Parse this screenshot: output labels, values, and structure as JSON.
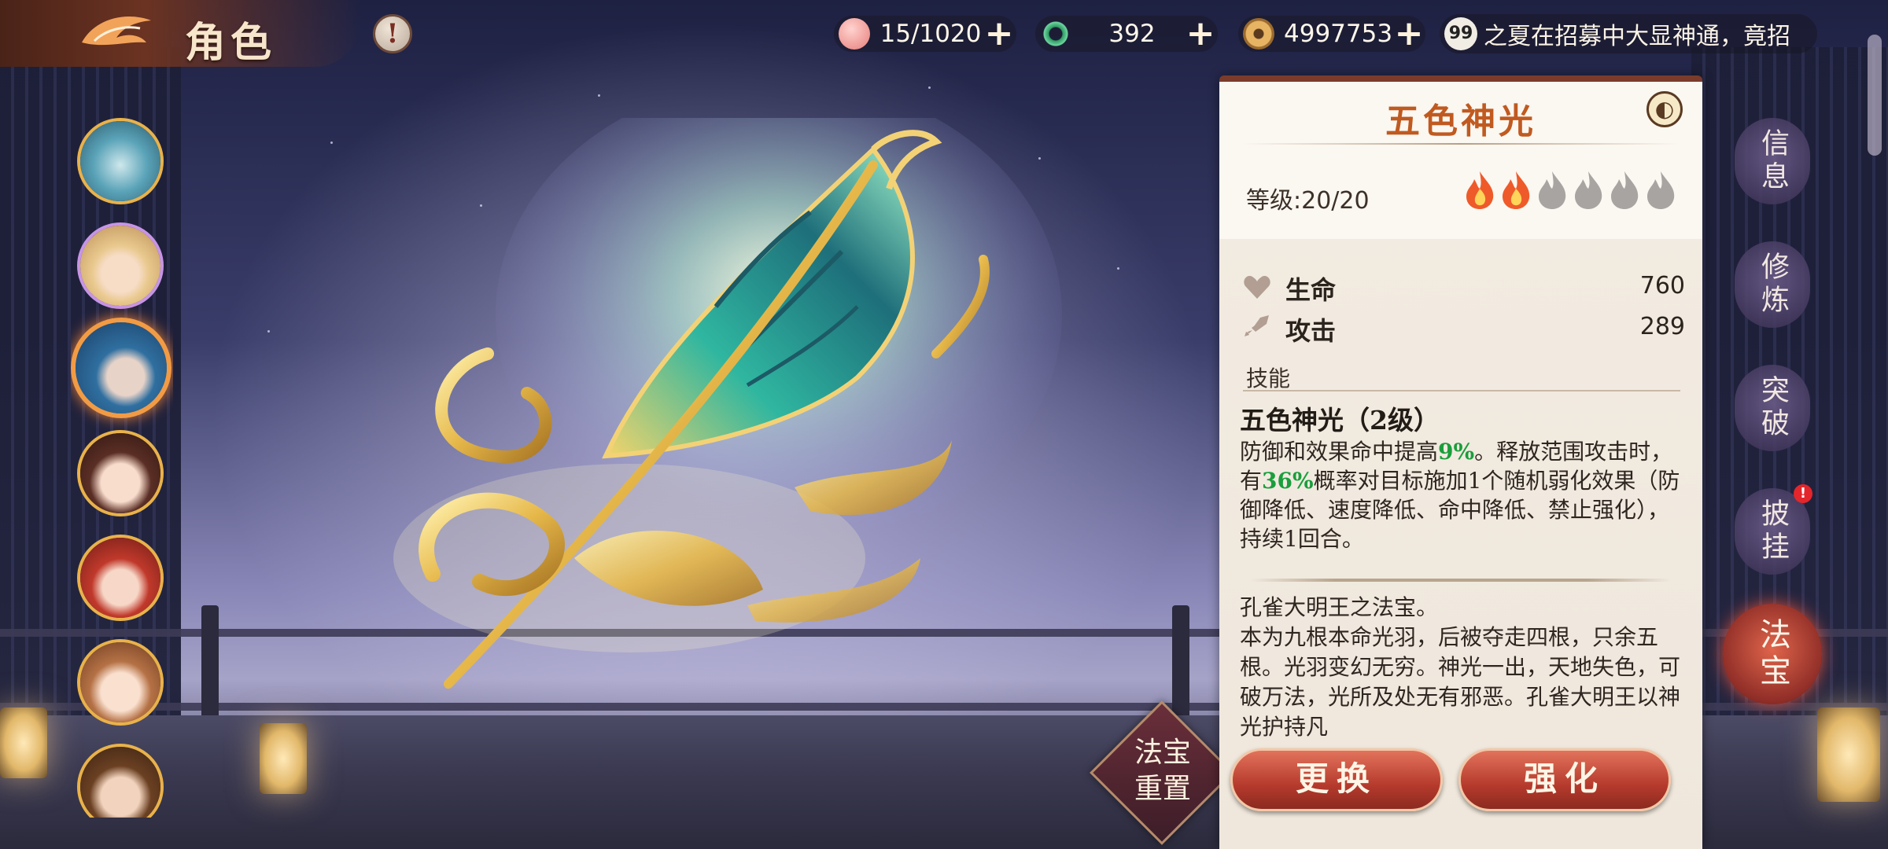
{
  "header": {
    "title": "角色",
    "alert_symbol": "!"
  },
  "resources": [
    {
      "name": "peach-icon",
      "value": "15/1020",
      "plus": "+",
      "color": "#f2a0a0"
    },
    {
      "name": "jade-ring-icon",
      "value": "392",
      "plus": "+",
      "color": "#3fa36b"
    },
    {
      "name": "copper-coin-icon",
      "value": "4997753",
      "plus": "+",
      "color": "#c9924a"
    }
  ],
  "ticker": {
    "icon_text": "99",
    "text": "之夏在招募中大显神通，竟招"
  },
  "characters": [
    {
      "name": "portrait-dragon",
      "selected": false
    },
    {
      "name": "portrait-blonde-girl",
      "selected": false
    },
    {
      "name": "portrait-blue-hair",
      "selected": true
    },
    {
      "name": "portrait-brown-hair-girl",
      "selected": false
    },
    {
      "name": "portrait-red-hair",
      "selected": false
    },
    {
      "name": "portrait-auburn-girl",
      "selected": false
    },
    {
      "name": "portrait-boy",
      "selected": false
    }
  ],
  "reset_button": {
    "line1": "法宝",
    "line2": "重置"
  },
  "panel": {
    "title": "五色神光",
    "level": "等级:20/20",
    "flames_total": 6,
    "flames_lit": 2,
    "stats": [
      {
        "icon": "heart-icon",
        "label": "生命",
        "value": "760"
      },
      {
        "icon": "sword-icon",
        "label": "攻击",
        "value": "289"
      }
    ],
    "skill_section": "技能",
    "skill_name": "五色神光（2级）",
    "skill_desc": {
      "p1": "防御和效果命中提高",
      "h1": "9%",
      "p2": "。释放范围攻击时，有",
      "h2": "36%",
      "p3": "概率对目标施加1个随机弱化效果（防御降低、速度降低、命中降低、禁止强化），持续1回合。"
    },
    "lore": "孔雀大明王之法宝。\n本为九根本命光羽，后被夺走四根，只余五根。光羽变幻无穷。神光一出，天地失色，可破万法，光所及处无有邪恶。孔雀大明王以神光护持凡",
    "buttons": {
      "replace": "更换",
      "enhance": "强化"
    }
  },
  "side_tabs": [
    {
      "name": "tab-info",
      "label": "信息",
      "active": false,
      "badge": ""
    },
    {
      "name": "tab-cultivate",
      "label": "修炼",
      "active": false,
      "badge": ""
    },
    {
      "name": "tab-breakthrough",
      "label": "突破",
      "active": false,
      "badge": ""
    },
    {
      "name": "tab-equip",
      "label": "披挂",
      "active": false,
      "badge": "!"
    },
    {
      "name": "tab-treasure",
      "label": "法宝",
      "active": true,
      "badge": ""
    }
  ],
  "colors": {
    "accent": "#c05a20",
    "highlight": "#1a9e3c",
    "button": "#b53a2c"
  }
}
